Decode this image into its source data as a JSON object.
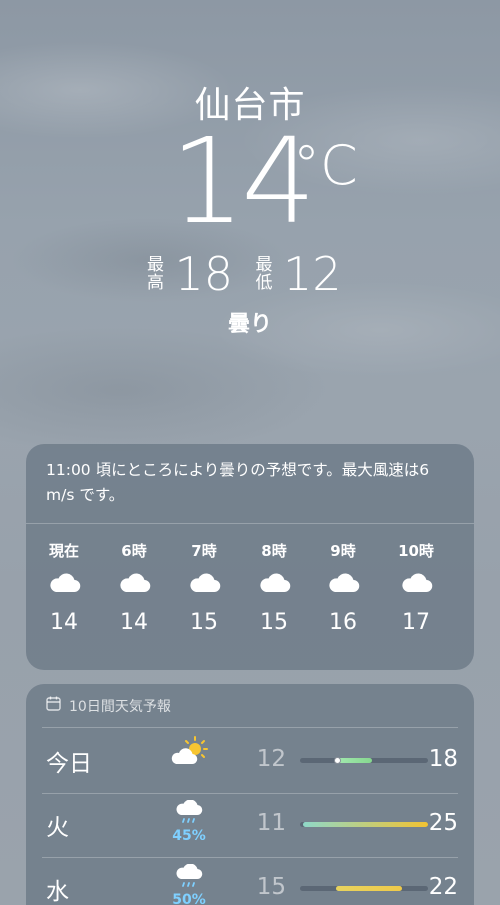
{
  "location": {
    "city": "仙台市",
    "temperature": "14",
    "unit": "°C",
    "high_label": "最高",
    "high": "18",
    "low_label": "最低",
    "low": "12",
    "condition": "曇り"
  },
  "hourly": {
    "summary": "11:00 頃にところにより曇りの予想です。最大風速は6 m/s です。",
    "items": [
      {
        "time": "現在",
        "icon": "cloud-icon",
        "temp": "14"
      },
      {
        "time": "6時",
        "icon": "cloud-icon",
        "temp": "14"
      },
      {
        "time": "7時",
        "icon": "cloud-icon",
        "temp": "15"
      },
      {
        "time": "8時",
        "icon": "cloud-icon",
        "temp": "15"
      },
      {
        "time": "9時",
        "icon": "cloud-icon",
        "temp": "16"
      },
      {
        "time": "10時",
        "icon": "cloud-icon",
        "temp": "17"
      }
    ]
  },
  "forecast": {
    "header": "10日間天気予報",
    "days": [
      {
        "day": "今日",
        "icon": "sun-behind-cloud-icon",
        "precip": "",
        "low": "12",
        "high": "18",
        "range_start": 0.28,
        "range_end": 0.56,
        "current": 0.29,
        "colors": [
          "#a3e9b0",
          "#86d78f"
        ]
      },
      {
        "day": "火",
        "icon": "cloud-rain-icon",
        "precip": "45%",
        "low": "11",
        "high": "25",
        "range_start": 0.02,
        "range_end": 1.0,
        "colors": [
          "#8fd8c8",
          "#f2c332"
        ]
      },
      {
        "day": "水",
        "icon": "cloud-rain-icon",
        "precip": "50%",
        "low": "15",
        "high": "22",
        "range_start": 0.28,
        "range_end": 0.8,
        "colors": [
          "#e7d35f",
          "#efca4a"
        ]
      }
    ]
  }
}
